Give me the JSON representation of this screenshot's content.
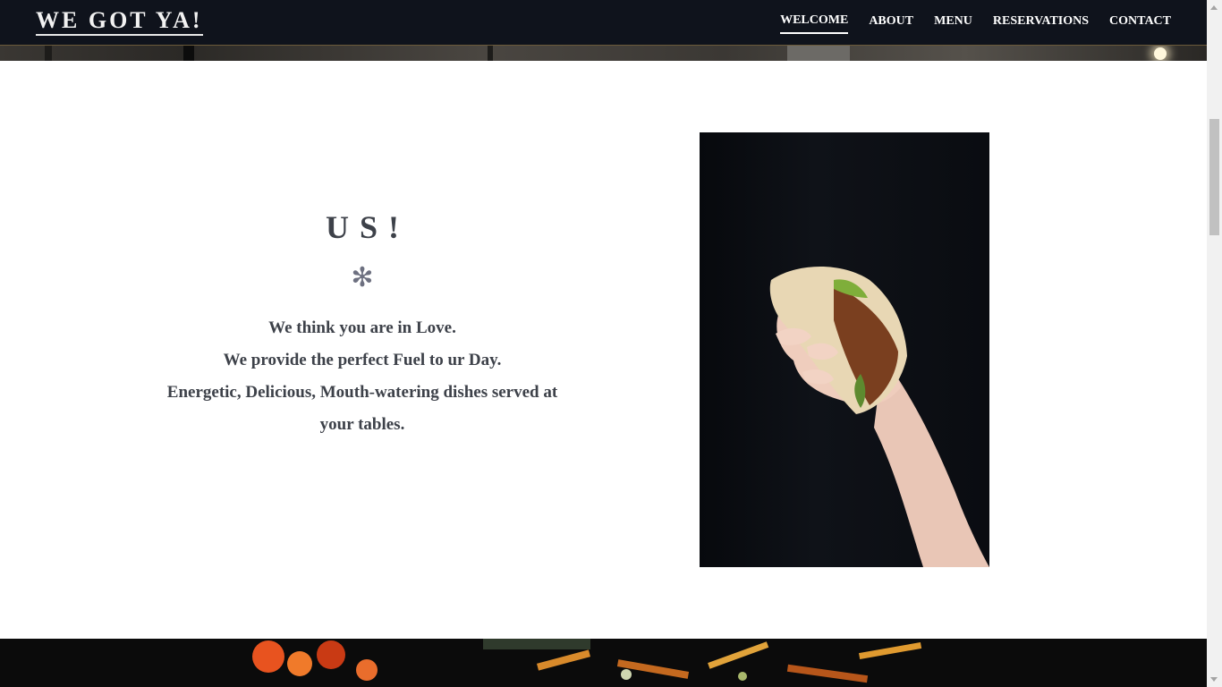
{
  "header": {
    "brand": "WE GOT YA!",
    "nav": [
      {
        "label": "WELCOME",
        "active": true
      },
      {
        "label": "ABOUT",
        "active": false
      },
      {
        "label": "MENU",
        "active": false
      },
      {
        "label": "RESERVATIONS",
        "active": false
      },
      {
        "label": "CONTACT",
        "active": false
      }
    ]
  },
  "about": {
    "heading": "US!",
    "divider_icon": "asterisk-icon",
    "lines": [
      "We think you are in Love.",
      "We provide the perfect Fuel to ur Day.",
      "Energetic, Delicious, Mouth-watering dishes served at",
      "your tables."
    ],
    "photo": "taco-photo"
  },
  "colors": {
    "navbar_bg": "#0f131c",
    "text": "#3d4149",
    "accent_icon": "#6d7080"
  }
}
